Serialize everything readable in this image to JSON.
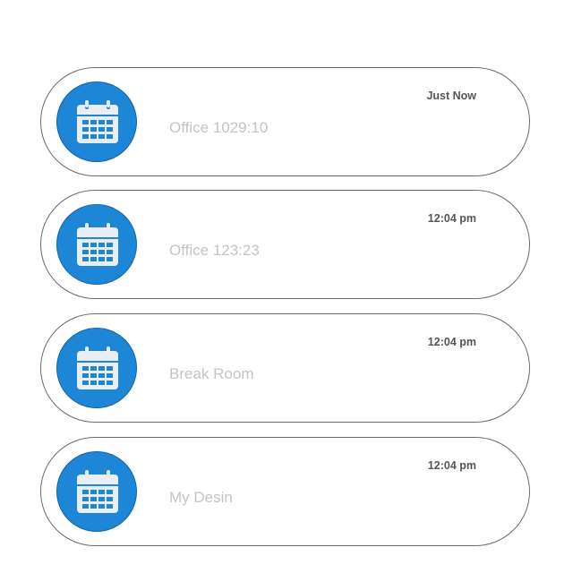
{
  "colors": {
    "icon_background": "#1e86d6",
    "icon_foreground": "#e8eef3",
    "title_text": "#c4c4c4",
    "time_text": "#555555",
    "card_border": "#6b6b6b"
  },
  "items": [
    {
      "icon": "calendar-icon",
      "title": "Office 1029:10",
      "time": "Just Now"
    },
    {
      "icon": "calendar-icon",
      "title": "Office 123:23",
      "time": "12:04 pm"
    },
    {
      "icon": "calendar-icon",
      "title": "Break Room",
      "time": "12:04 pm"
    },
    {
      "icon": "calendar-icon",
      "title": "My Desin",
      "time": "12:04 pm"
    }
  ]
}
